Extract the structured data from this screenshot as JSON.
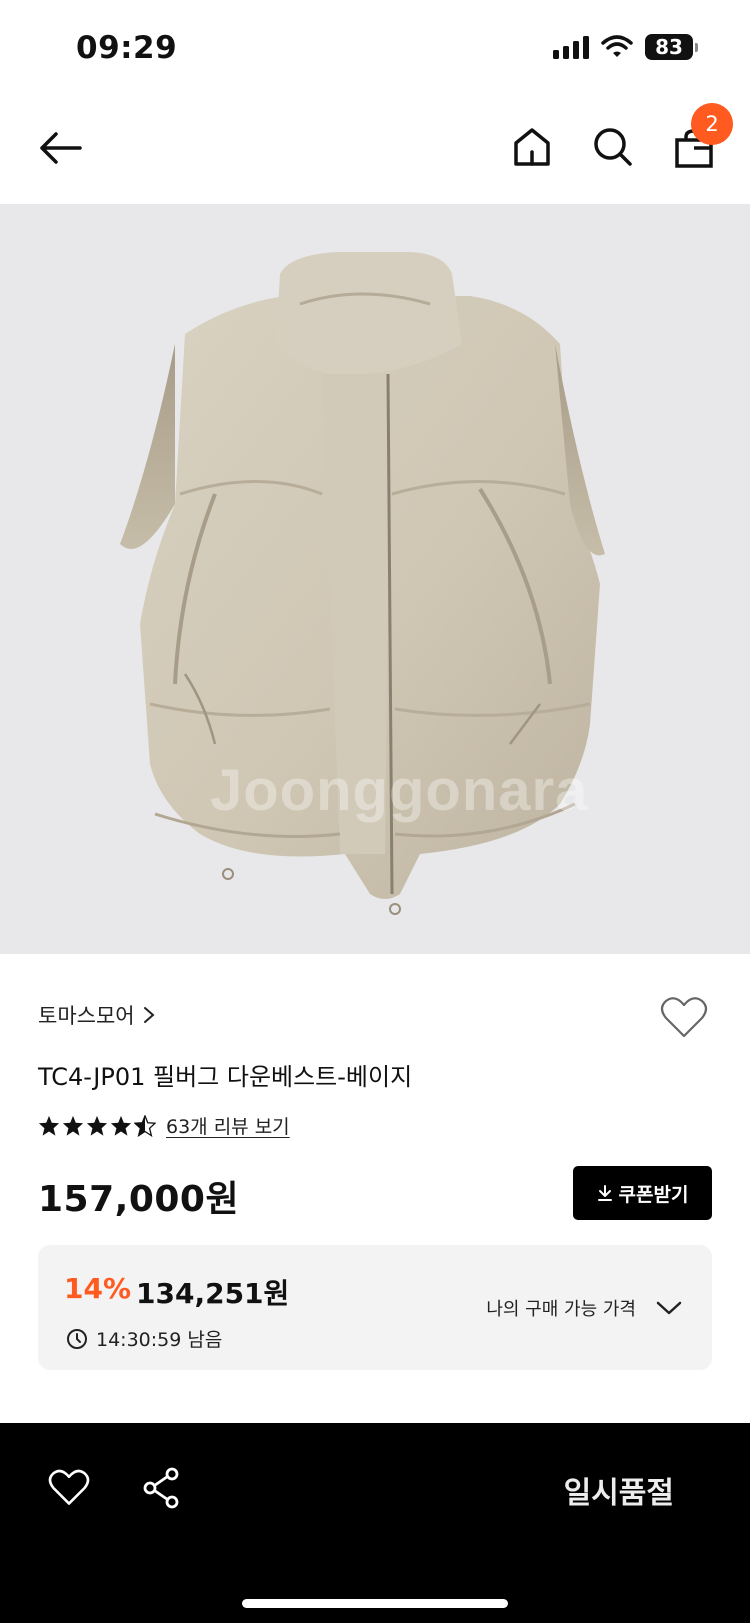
{
  "status_bar": {
    "time": "09:29",
    "battery": "83"
  },
  "nav": {
    "cart_count": "2"
  },
  "product_image": {
    "watermark": "Joonggonara"
  },
  "product": {
    "brand": "토마스모어",
    "title": "TC4-JP01 필버그 다운베스트-베이지",
    "rating": 4.5,
    "review_link": "63개 리뷰 보기",
    "price": "157,000원"
  },
  "coupon_button": {
    "label": "쿠폰받기"
  },
  "sale": {
    "discount": "14%",
    "price": "134,251원",
    "timer": "14:30:59 남음",
    "price_check": "나의 구매 가능 가격"
  },
  "bottom_bar": {
    "soldout_label": "일시품절"
  },
  "colors": {
    "accent": "#ff5a1f",
    "dark": "#000000",
    "panel": "#f3f3f3",
    "image_bg": "#e8e8ea"
  }
}
